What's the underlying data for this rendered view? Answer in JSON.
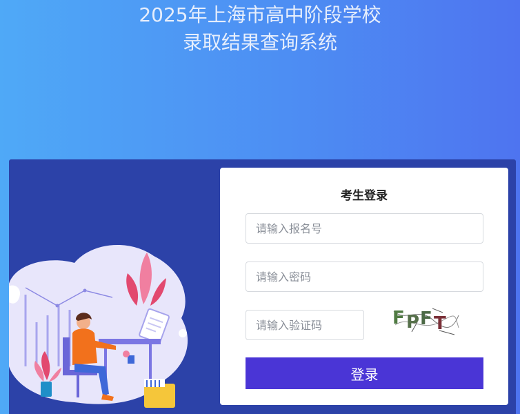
{
  "header": {
    "title_line1": "2025年上海市高中阶段学校",
    "title_line2": "录取结果查询系统"
  },
  "login": {
    "title": "考生登录",
    "username_placeholder": "请输入报名号",
    "password_placeholder": "请输入密码",
    "captcha_placeholder": "请输入验证码",
    "captcha_text": "FPFT",
    "submit_label": "登录"
  },
  "colors": {
    "background_start": "#4fa9f7",
    "background_end": "#4e74f0",
    "panel": "#2c42a8",
    "button": "#4a35d6"
  },
  "icons": {
    "illustration": "person-at-desk-illustration",
    "captcha": "captcha-image"
  }
}
